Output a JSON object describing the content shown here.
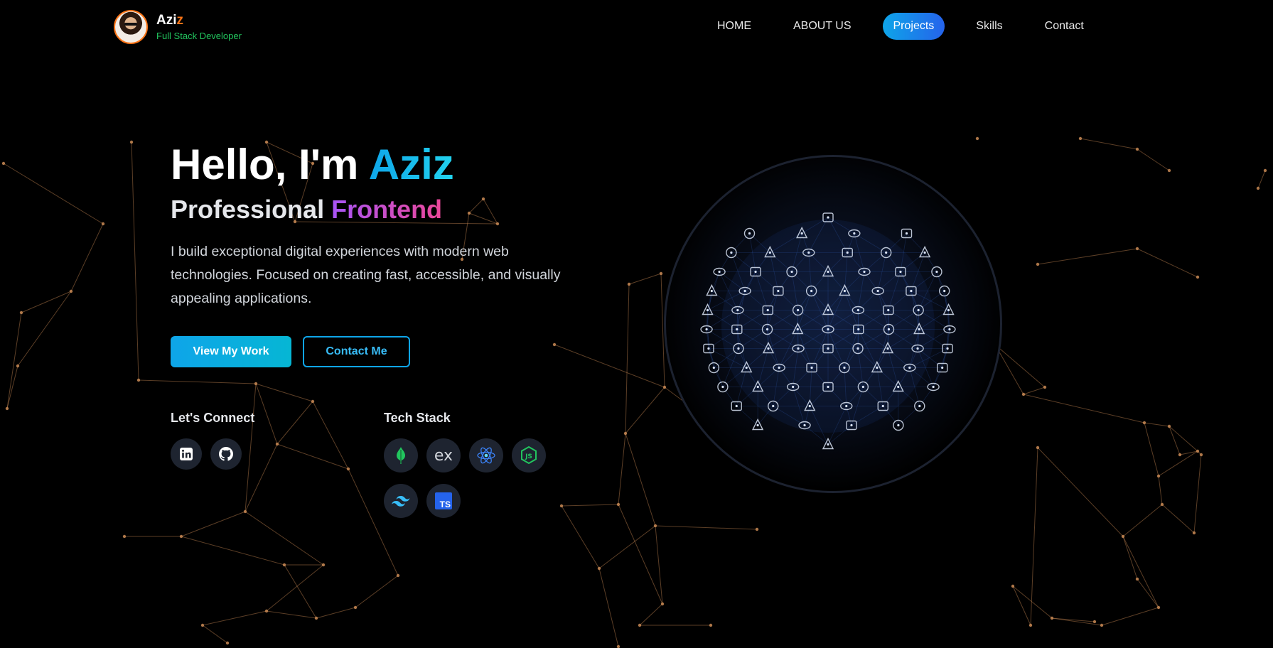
{
  "brand": {
    "name_main": "Azi",
    "name_accent": "z",
    "role": "Full Stack Developer"
  },
  "nav": {
    "items": [
      {
        "label": "HOME",
        "active": false
      },
      {
        "label": "ABOUT US",
        "active": false
      },
      {
        "label": "Projects",
        "active": true
      },
      {
        "label": "Skills",
        "active": false
      },
      {
        "label": "Contact",
        "active": false
      }
    ]
  },
  "hero": {
    "greeting": "Hello, I'm ",
    "name": "Aziz",
    "subtitle_prefix": "Professional ",
    "subtitle_role": "Frontend",
    "description": "I build exceptional digital experiences with modern web technologies. Focused on creating fast, accessible, and visually appealing applications.",
    "primary_button": "View My Work",
    "secondary_button": "Contact Me"
  },
  "connect": {
    "heading": "Let's Connect",
    "icons": [
      "linkedin-icon",
      "github-icon"
    ]
  },
  "tech_stack": {
    "heading": "Tech Stack",
    "icons": [
      "mongodb-icon",
      "express-icon",
      "react-icon",
      "nodejs-icon",
      "tailwind-icon",
      "typescript-icon"
    ],
    "express_text": "ex",
    "typescript_text": "TS"
  },
  "colors": {
    "background": "#000000",
    "brand_accent": "#f97316",
    "role_green": "#22c55e",
    "primary_blue": "#0ea5e9",
    "gradient_purple": "#a855f7",
    "gradient_pink": "#ec4899",
    "network_lines": "#c98a55"
  }
}
